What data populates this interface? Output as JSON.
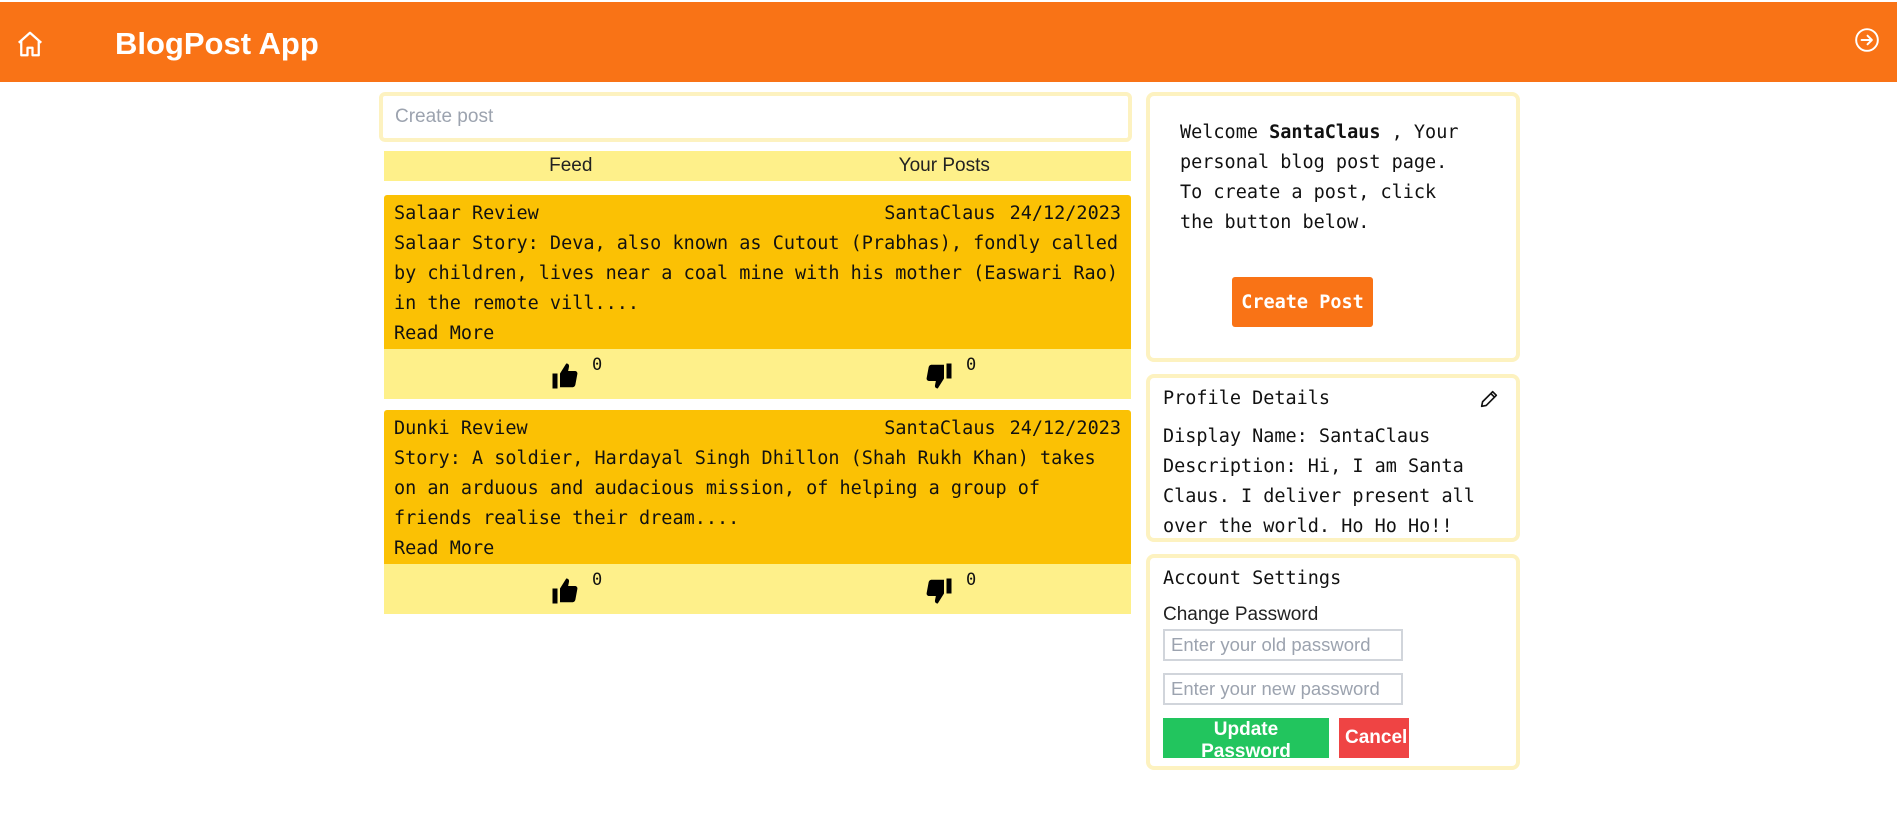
{
  "header": {
    "title": "BlogPost App",
    "home_icon": "home-icon",
    "logout_icon": "logout-arrow-icon",
    "color": "#f97316"
  },
  "create": {
    "placeholder": "Create post"
  },
  "tabs": [
    {
      "label": "Feed"
    },
    {
      "label": "Your Posts"
    }
  ],
  "posts": [
    {
      "title": "Salaar Review",
      "author": "SantaClaus",
      "date": "24/12/2023",
      "excerpt": "Salaar Story: Deva, also known as Cutout (Prabhas), fondly called by children, lives near a coal mine with his mother (Easwari Rao) in the remote vill....",
      "read_more": "Read More",
      "likes": "0",
      "dislikes": "0"
    },
    {
      "title": "Dunki Review",
      "author": "SantaClaus",
      "date": "24/12/2023",
      "excerpt": "Story: A soldier, Hardayal Singh Dhillon (Shah Rukh Khan) takes on an arduous and audacious mission, of helping a group of friends realise their dream....",
      "read_more": "Read More",
      "likes": "0",
      "dislikes": "0"
    }
  ],
  "welcome": {
    "prefix": "Welcome ",
    "username": "SantaClaus",
    "suffix": " , Your personal blog post page. To create a post, click the button below.",
    "button": "Create Post"
  },
  "profile": {
    "title": "Profile Details",
    "display_name": "Display Name: SantaClaus",
    "description": "Description: Hi, I am Santa Claus. I deliver present all over the world. Ho Ho Ho!!"
  },
  "account": {
    "title": "Account Settings",
    "change_password": "Change Password",
    "old_placeholder": "Enter your old password",
    "new_placeholder": "Enter your new password",
    "update_button": "Update Password",
    "cancel_button": "Cancel"
  },
  "colors": {
    "accent": "#f97316",
    "post_bg": "#fbc104",
    "soft_yellow": "#fef08a",
    "update": "#22c55e",
    "cancel": "#ef4444"
  }
}
